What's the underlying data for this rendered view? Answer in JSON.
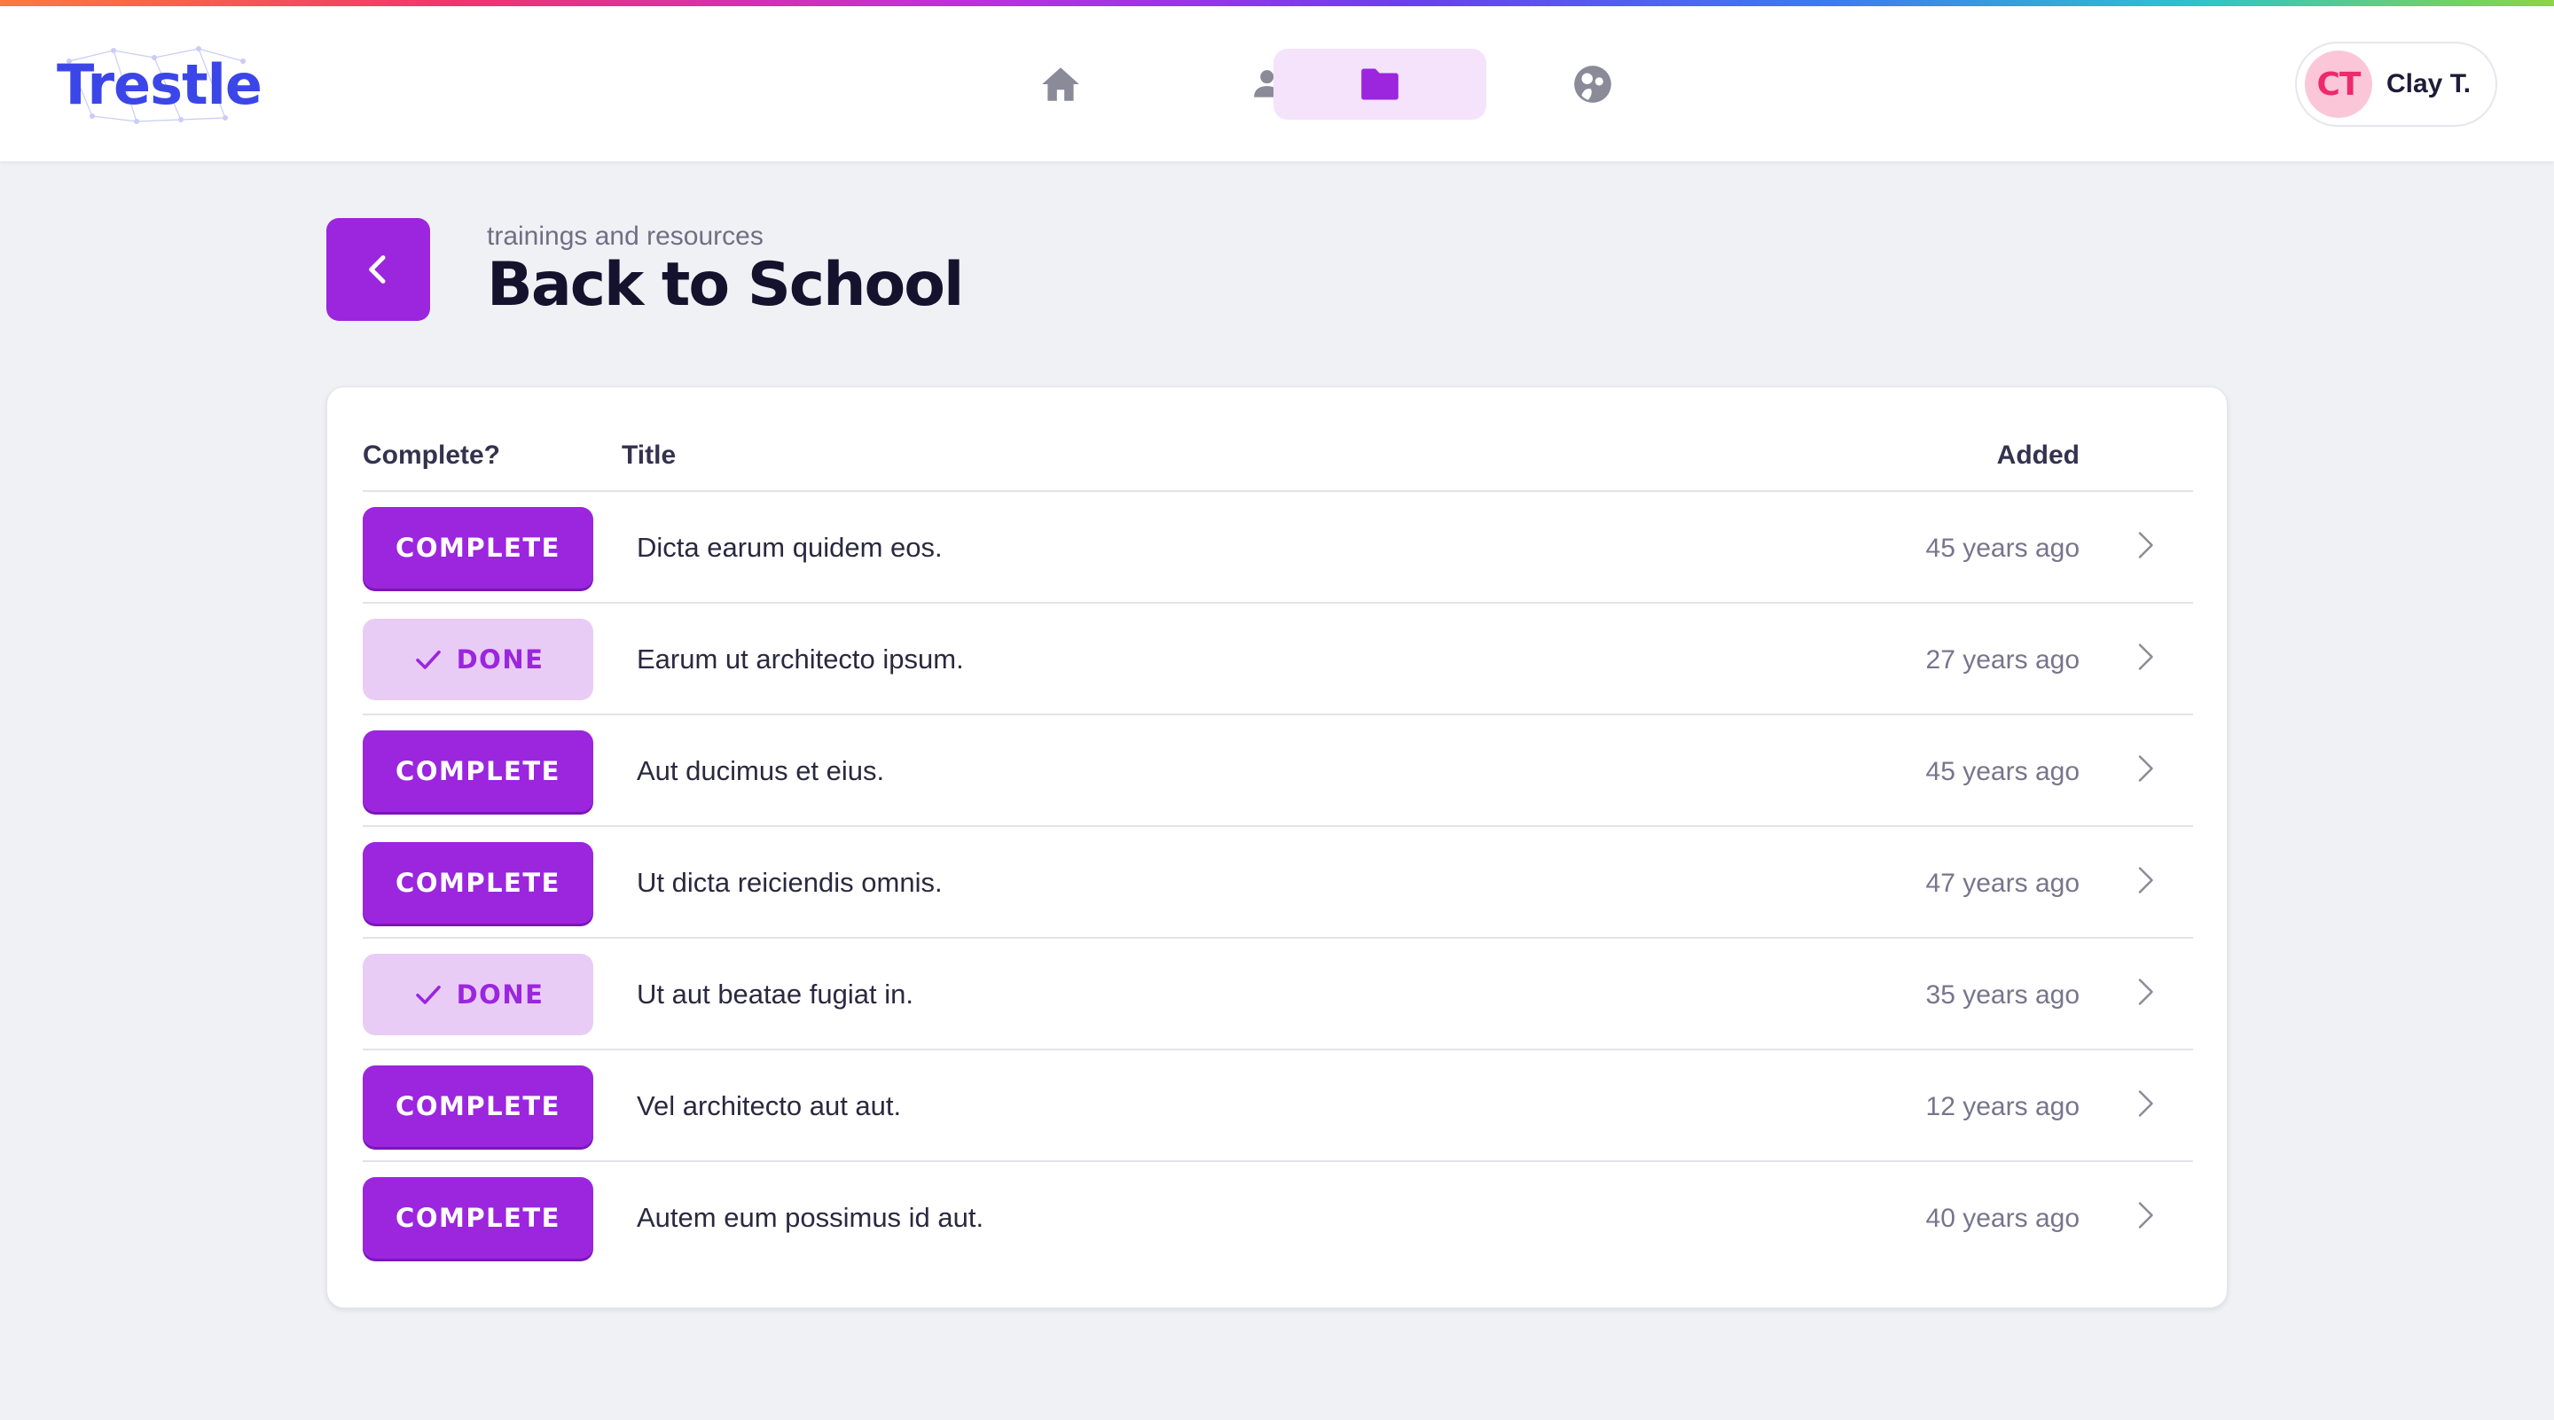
{
  "app": {
    "logo_text": "Trestle",
    "accent_color": "#9b26de",
    "logo_color": "#3b46e8"
  },
  "nav": {
    "items": [
      {
        "name": "home",
        "icon": "home-icon",
        "active": false
      },
      {
        "name": "people",
        "icon": "people-icon",
        "active": false
      },
      {
        "name": "resources",
        "icon": "folder-icon",
        "active": true
      },
      {
        "name": "community",
        "icon": "globe-icon",
        "active": false
      }
    ]
  },
  "user": {
    "initials": "CT",
    "name": "Clay T."
  },
  "header": {
    "breadcrumb": "trainings and resources",
    "title": "Back to School"
  },
  "table": {
    "columns": {
      "complete": "Complete?",
      "title": "Title",
      "added": "Added"
    },
    "rows": [
      {
        "status": "complete",
        "button_label": "COMPLETE",
        "title": "Dicta earum quidem eos.",
        "added": "45 years ago"
      },
      {
        "status": "done",
        "button_label": "DONE",
        "title": "Earum ut architecto ipsum.",
        "added": "27 years ago"
      },
      {
        "status": "complete",
        "button_label": "COMPLETE",
        "title": "Aut ducimus et eius.",
        "added": "45 years ago"
      },
      {
        "status": "complete",
        "button_label": "COMPLETE",
        "title": "Ut dicta reiciendis omnis.",
        "added": "47 years ago"
      },
      {
        "status": "done",
        "button_label": "DONE",
        "title": "Ut aut beatae fugiat in.",
        "added": "35 years ago"
      },
      {
        "status": "complete",
        "button_label": "COMPLETE",
        "title": "Vel architecto aut aut.",
        "added": "12 years ago"
      },
      {
        "status": "complete",
        "button_label": "COMPLETE",
        "title": "Autem eum possimus id aut.",
        "added": "40 years ago"
      }
    ]
  }
}
